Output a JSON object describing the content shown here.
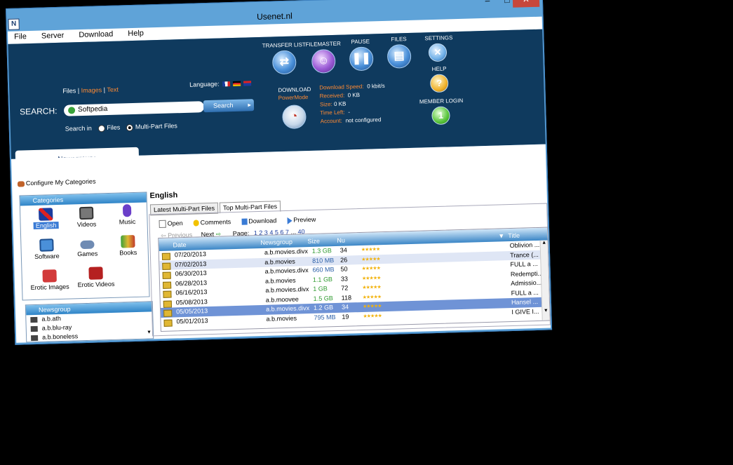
{
  "window": {
    "title": "Usenet.nl",
    "close": "✕",
    "minimize": "–",
    "maximize": "□"
  },
  "menu": [
    "File",
    "Server",
    "Download",
    "Help"
  ],
  "toolbar_buttons": {
    "transfer_list": "TRANSFER LIST",
    "filemaster": "FILEMASTER",
    "pause": "PAUSE",
    "files": "FILES",
    "settings": "SETTINGS",
    "help": "HELP",
    "member_login": "MEMBER LOGIN",
    "download": "DOWNLOAD",
    "powermode": "PowerMode"
  },
  "search": {
    "types": [
      "Files",
      "Images",
      "Text"
    ],
    "label": "SEARCH:",
    "value": "Softpedia",
    "button": "Search",
    "search_in": "Search in",
    "option_files": "Files",
    "option_multipart": "Multi-Part Files",
    "language_label": "Language:"
  },
  "status": {
    "download_speed_label": "Download Speed:",
    "download_speed": "0 kbit/s",
    "received_label": "Received:",
    "received": "0 KB",
    "size_label": "Size:",
    "size": "0 KB",
    "time_left_label": "Time Left:",
    "time_left": "-",
    "account_label": "Account:",
    "account": "not configured"
  },
  "left": {
    "tab": "Newsgroups",
    "configure": "Configure My Categories",
    "categories_header": "Categories",
    "categories": [
      "English",
      "Videos",
      "Music",
      "Software",
      "Games",
      "Books",
      "Erotic Images",
      "Erotic Videos"
    ],
    "newsgroup_header": "Newsgroup",
    "newsgroups": [
      "a.b.ath",
      "a.b.blu-ray",
      "a.b.boneless"
    ]
  },
  "main": {
    "heading": "English",
    "tabs": [
      "Latest Multi-Part Files",
      "Top Multi-Part Files"
    ],
    "actions": [
      "Open",
      "Comments",
      "Download",
      "Preview"
    ],
    "previous": "Previous",
    "next": "Next",
    "page_label": "Page:",
    "pages": [
      "1",
      "2",
      "3",
      "4",
      "5",
      "6",
      "7"
    ],
    "ellipsis": "...",
    "last_page": "40",
    "columns": [
      "Date",
      "Newsgroup",
      "Size",
      "Nu",
      "Title"
    ],
    "rows": [
      {
        "date": "07/20/2013",
        "group": "a.b.movies.divx",
        "size": "1.3 GB",
        "num": "34",
        "title": "Oblivion ..."
      },
      {
        "date": "07/02/2013",
        "group": "a.b.movies",
        "size": "810 MB",
        "num": "26",
        "title": "Trance (..."
      },
      {
        "date": "06/30/2013",
        "group": "a.b.movies.divx",
        "size": "660 MB",
        "num": "50",
        "title": "FULL a ..."
      },
      {
        "date": "06/28/2013",
        "group": "a.b.movies",
        "size": "1.1 GB",
        "num": "33",
        "title": "Redempti..."
      },
      {
        "date": "06/16/2013",
        "group": "a.b.movies.divx",
        "size": "1 GB",
        "num": "72",
        "title": "Admissio..."
      },
      {
        "date": "05/08/2013",
        "group": "a.b.moovee",
        "size": "1.5 GB",
        "num": "118",
        "title": "FULL a ..."
      },
      {
        "date": "05/05/2013",
        "group": "a.b.movies.divx",
        "size": "1.2 GB",
        "num": "34",
        "title": "Hansel ..."
      },
      {
        "date": "05/01/2013",
        "group": "a.b.movies",
        "size": "795 MB",
        "num": "19",
        "title": "I GIVE I..."
      }
    ],
    "rating_glyph": "★★★★★",
    "extra_title": "I GIVE I..."
  },
  "colors": {
    "banner": "#0f3a5e",
    "accent": "#ff8a33",
    "selection": "#6f93d6"
  }
}
